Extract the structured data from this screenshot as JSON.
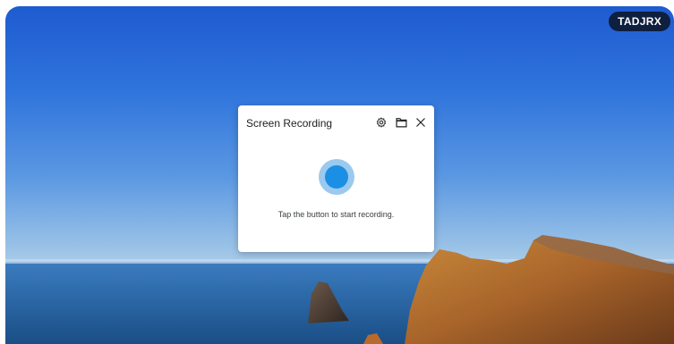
{
  "desktop": {
    "user_badge": "TADJRX"
  },
  "dialog": {
    "title": "Screen Recording",
    "hint": "Tap the button to start recording.",
    "actions": [
      {
        "icon": "gear-icon"
      },
      {
        "icon": "folder-icon"
      },
      {
        "icon": "close-icon"
      }
    ]
  },
  "colors": {
    "record_outer": "#9cc9ee",
    "record_inner": "#1a8fe3",
    "badge_bg": "#0e1f3f"
  }
}
